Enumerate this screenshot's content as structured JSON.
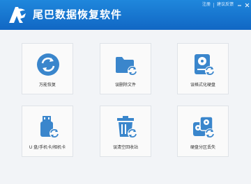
{
  "app": {
    "title": "尾巴数据恢复软件"
  },
  "top_links": {
    "register": "注册",
    "feedback": "建议反馈"
  },
  "cards": [
    {
      "label": "万能恢复"
    },
    {
      "label": "误删除文件"
    },
    {
      "label": "误格式化硬盘"
    },
    {
      "label": "U 盘/手机卡/相机卡"
    },
    {
      "label": "误清空回收站"
    },
    {
      "label": "硬盘分区丢失"
    }
  ],
  "colors": {
    "header": "#1a7bd6",
    "accent": "#3a86cc",
    "background": "#f2f4f7"
  }
}
